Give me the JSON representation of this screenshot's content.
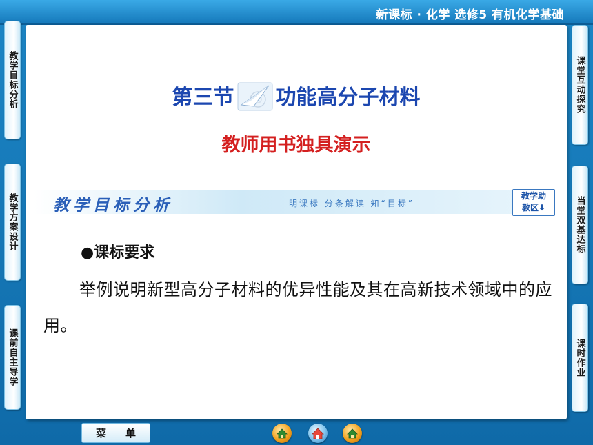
{
  "header": {
    "title": "新课标 · 化学   选修5   有机化学基础"
  },
  "left_tabs": [
    {
      "label": "教学目标分析"
    },
    {
      "label": "教学方案设计"
    },
    {
      "label": "课前自主导学"
    }
  ],
  "right_tabs": [
    {
      "label": "课堂互动探究"
    },
    {
      "label": "当堂双基达标"
    },
    {
      "label": "课时作业"
    }
  ],
  "main": {
    "title_part1": "第三节",
    "title_part2": "功能高分子材料",
    "subtitle": "教师用书独具演示",
    "banner": {
      "title": "教学目标分析",
      "subtitle": "明课标  分条解读  知“目标”",
      "tag_line1": "教学助",
      "tag_line2": "教区⬇"
    },
    "section_heading": "●课标要求",
    "paragraph": "举例说明新型高分子材料的优异性能及其在高新技术领域中的应用。"
  },
  "footer": {
    "menu_label": "菜单",
    "nav_icons": [
      "back-home-icon",
      "home-icon",
      "forward-icon"
    ]
  },
  "colors": {
    "title_blue": "#1c47b0",
    "subtitle_red": "#d42020",
    "frame_blue": "#1c86c6"
  }
}
